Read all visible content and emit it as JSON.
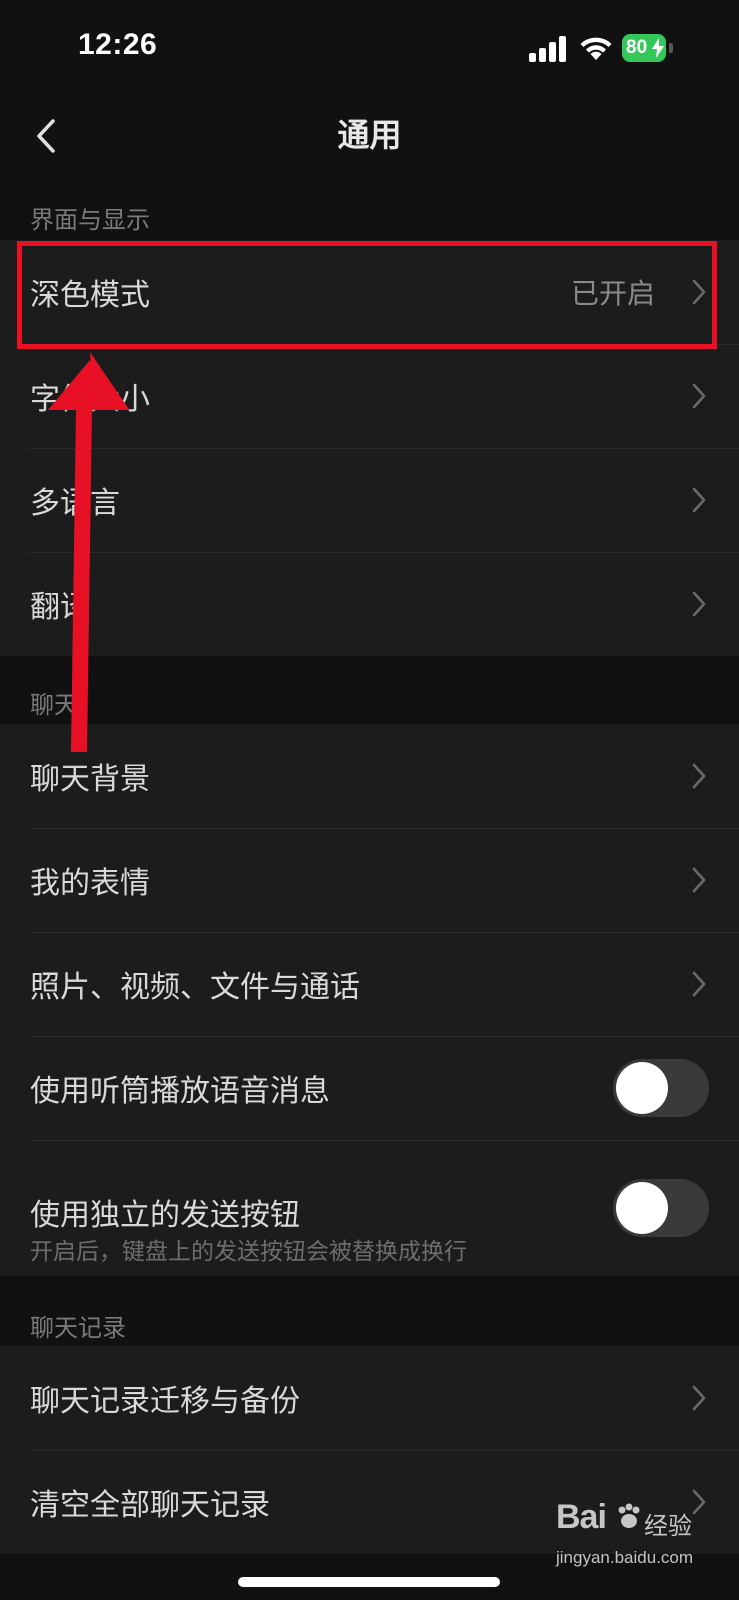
{
  "status_bar": {
    "time": "12:26",
    "battery_level": "80"
  },
  "nav": {
    "title": "通用"
  },
  "sections": {
    "display": {
      "header": "界面与显示",
      "items": {
        "dark_mode": {
          "label": "深色模式",
          "value": "已开启"
        },
        "font_size": {
          "label": "字体大小"
        },
        "language": {
          "label": "多语言"
        },
        "translate": {
          "label": "翻译"
        }
      }
    },
    "chat": {
      "header": "聊天",
      "items": {
        "chat_background": {
          "label": "聊天背景"
        },
        "my_stickers": {
          "label": "我的表情"
        },
        "media_files_calls": {
          "label": "照片、视频、文件与通话"
        },
        "earpiece_playback": {
          "label": "使用听筒播放语音消息",
          "enabled": false
        },
        "send_button": {
          "label": "使用独立的发送按钮",
          "description": "开启后，键盘上的发送按钮会被替换成换行",
          "enabled": false
        }
      }
    },
    "history": {
      "header": "聊天记录",
      "items": {
        "migrate_backup": {
          "label": "聊天记录迁移与备份"
        },
        "clear_all": {
          "label": "清空全部聊天记录"
        }
      }
    }
  },
  "watermark": {
    "brand": "Bai",
    "brand_suffix": "经验",
    "url": "jingyan.baidu.com"
  },
  "colors": {
    "background": "#111111",
    "cell": "#1c1c1c",
    "annotation_red": "#e81024",
    "battery_green": "#34c759"
  }
}
